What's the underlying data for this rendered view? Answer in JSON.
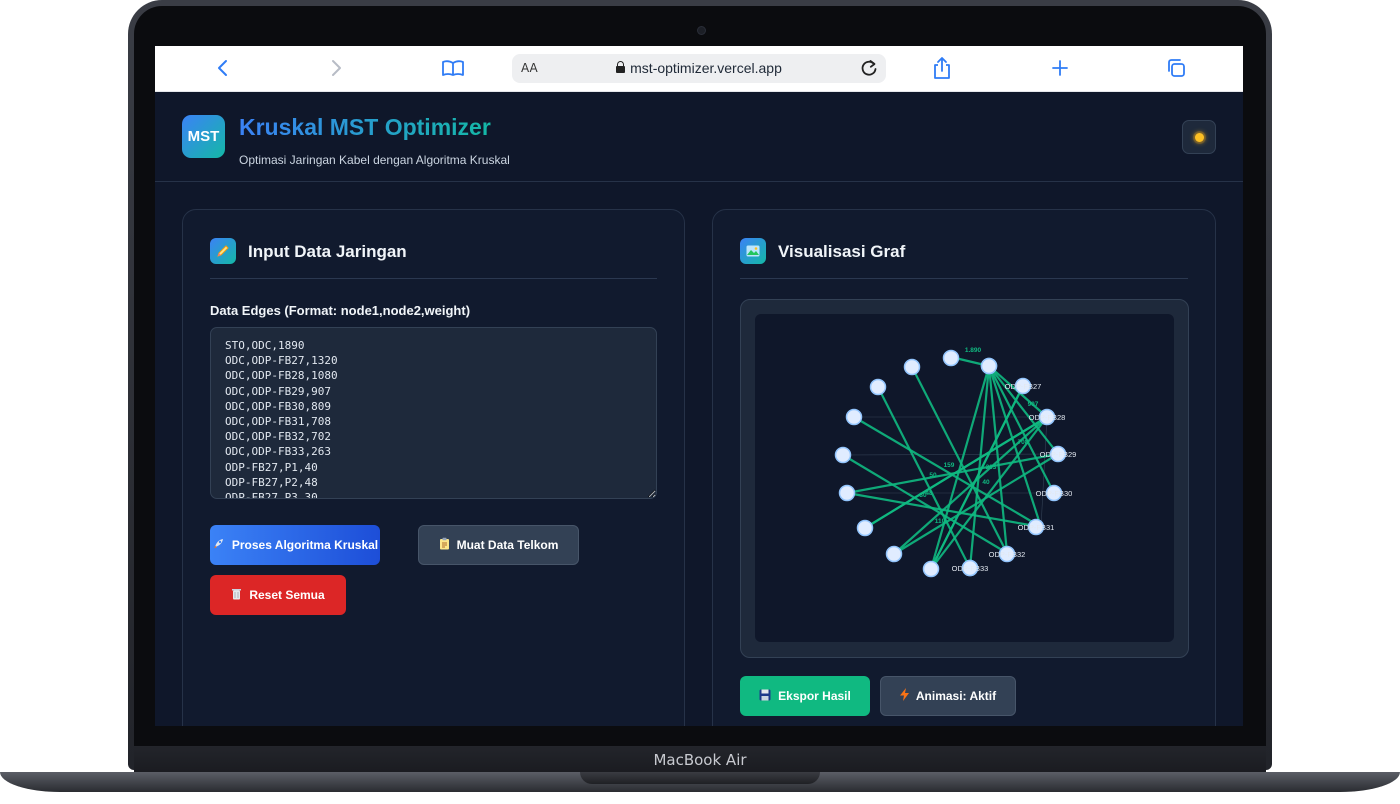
{
  "device": {
    "label": "MacBook Air"
  },
  "browser": {
    "text_size_label": "AA",
    "url": "mst-optimizer.vercel.app",
    "icons": [
      "back-icon",
      "forward-icon",
      "bookmarks-icon",
      "lock-icon",
      "reload-icon",
      "share-icon",
      "new-tab-icon",
      "tabs-icon"
    ]
  },
  "header": {
    "logo_text": "MST",
    "title": "Kruskal MST Optimizer",
    "subtitle": "Optimasi Jaringan Kabel dengan Algoritma Kruskal",
    "theme_icon": "sun-icon"
  },
  "input_panel": {
    "title": "Input Data Jaringan",
    "icon": "pencil-icon",
    "field_label": "Data Edges (Format: node1,node2,weight)",
    "edges_text": "STO,ODC,1890\nODC,ODP-FB27,1320\nODC,ODP-FB28,1080\nODC,ODP-FB29,907\nODC,ODP-FB30,809\nODC,ODP-FB31,708\nODC,ODP-FB32,702\nODC,ODP-FB33,263\nODP-FB27,P1,40\nODP-FB27,P2,48\nODP-FB27,P3,30",
    "buttons": {
      "process": {
        "label": "Proses Algoritma Kruskal",
        "icon": "rocket-icon"
      },
      "load": {
        "label": "Muat Data Telkom",
        "icon": "clipboard-icon"
      },
      "reset": {
        "label": "Reset Semua",
        "icon": "trash-icon"
      }
    }
  },
  "graph_panel": {
    "title": "Visualisasi Graf",
    "icon": "image-icon",
    "buttons": {
      "export": {
        "label": "Ekspor Hasil",
        "icon": "save-icon"
      },
      "animation": {
        "label": "Animasi: Aktif",
        "icon": "lightning-icon"
      }
    },
    "nodes": [
      {
        "id": "n0",
        "label": ""
      },
      {
        "id": "n1",
        "label": ""
      },
      {
        "id": "n2",
        "label": ""
      },
      {
        "id": "n3",
        "label": ""
      },
      {
        "id": "n4",
        "label": ""
      },
      {
        "id": "n5",
        "label": ""
      },
      {
        "id": "n6",
        "label": ""
      },
      {
        "id": "n7",
        "label": ""
      },
      {
        "id": "n8",
        "label": ""
      },
      {
        "id": "n9",
        "label": ""
      },
      {
        "id": "n10",
        "label": ""
      },
      {
        "id": "n11",
        "label": ""
      },
      {
        "id": "n12",
        "label": "ODP-FB27"
      },
      {
        "id": "n13",
        "label": "ODP-FB28"
      },
      {
        "id": "n14",
        "label": "ODP-FB29"
      },
      {
        "id": "n15",
        "label": "ODP-FB30"
      },
      {
        "id": "n16",
        "label": "ODP-FB31"
      },
      {
        "id": "n17",
        "label": "ODP-FB32"
      },
      {
        "id": "n18",
        "label": "ODP-FB33"
      }
    ],
    "edge_weight_labels": [
      "1.890",
      "907",
      "708",
      "263",
      "159",
      "50",
      "40",
      "48",
      "30",
      "110"
    ],
    "colors": {
      "edge": "#10b981",
      "node_fill": "#e0ecff",
      "node_stroke": "#93c5fd",
      "label": "#e2e8f0"
    }
  }
}
